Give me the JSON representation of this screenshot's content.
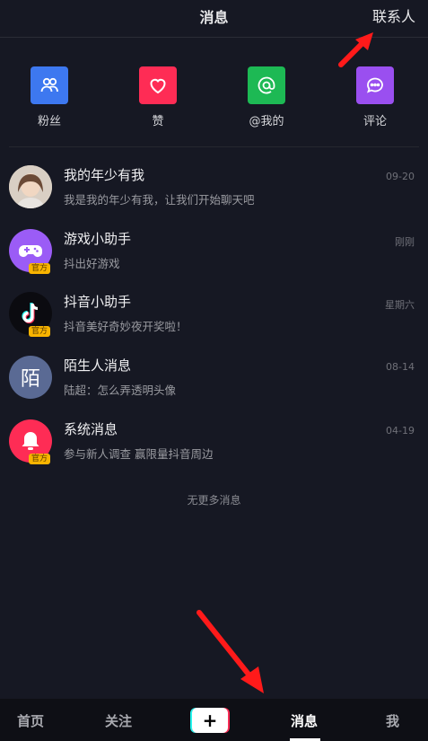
{
  "header": {
    "title": "消息",
    "contacts": "联系人"
  },
  "quick_actions": [
    {
      "label": "粉丝",
      "icon": "fans-icon",
      "color": "#3d78f0"
    },
    {
      "label": "赞",
      "icon": "heart-icon",
      "color": "#fe2c55"
    },
    {
      "label": "@我的",
      "icon": "at-icon",
      "color": "#1db954"
    },
    {
      "label": "评论",
      "icon": "comment-icon",
      "color": "#9a4ff0"
    }
  ],
  "messages": [
    {
      "name": "我的年少有我",
      "preview": "我是我的年少有我，让我们开始聊天吧",
      "time": "09-20"
    },
    {
      "name": "游戏小助手",
      "preview": "抖出好游戏",
      "time": "刚刚",
      "badge": "官方"
    },
    {
      "name": "抖音小助手",
      "preview": "抖音美好奇妙夜开奖啦！",
      "time": "星期六",
      "badge": "官方"
    },
    {
      "name": "陌生人消息",
      "preview": "陆超：怎么弄透明头像",
      "time": "08-14",
      "avatar_char": "陌"
    },
    {
      "name": "系统消息",
      "preview": "参与新人调查 赢限量抖音周边",
      "time": "04-19",
      "badge": "官方"
    }
  ],
  "no_more": "无更多消息",
  "tabbar": {
    "home": "首页",
    "follow": "关注",
    "plus": "+",
    "messages": "消息",
    "me": "我"
  },
  "colors": {
    "background": "#161823",
    "accent": "#fe2c55",
    "arrow": "#ff1a1a"
  }
}
